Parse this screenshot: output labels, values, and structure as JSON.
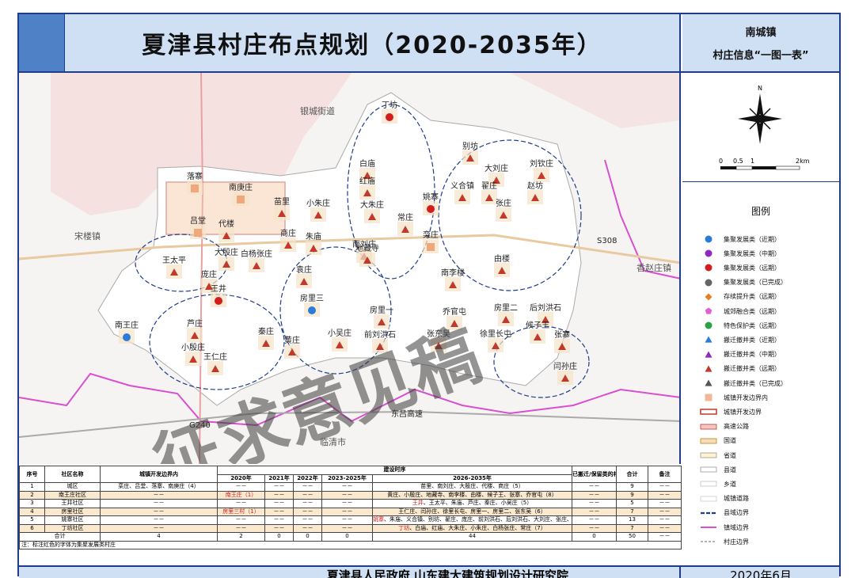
{
  "header": {
    "title": "夏津县村庄布点规划（2020-2035年）",
    "town": "南城镇",
    "subtitle": "村庄信息“一图一表”"
  },
  "map": {
    "places": [
      {
        "name": "丁坊",
        "sym": "red-circle"
      },
      {
        "name": "别坊",
        "sym": "red-triangle"
      },
      {
        "name": "大刘庄",
        "sym": "red-triangle"
      },
      {
        "name": "刘钦庄",
        "sym": "red-triangle"
      },
      {
        "name": "白庙",
        "sym": "red-triangle"
      },
      {
        "name": "红庙",
        "sym": "red-triangle"
      },
      {
        "name": "义合镇",
        "sym": "red-triangle"
      },
      {
        "name": "翟庄",
        "sym": "red-triangle"
      },
      {
        "name": "赵坊",
        "sym": "red-triangle"
      },
      {
        "name": "落寨",
        "sym": "orange-square"
      },
      {
        "name": "南庚庄",
        "sym": "orange-square"
      },
      {
        "name": "苗里",
        "sym": "red-triangle"
      },
      {
        "name": "小朱庄",
        "sym": "red-triangle"
      },
      {
        "name": "大朱庄",
        "sym": "red-triangle"
      },
      {
        "name": "姚寨",
        "sym": "red-circle"
      },
      {
        "name": "张庄",
        "sym": "red-triangle"
      },
      {
        "name": "常庄",
        "sym": "red-triangle"
      },
      {
        "name": "栾庄",
        "sym": "orange-square"
      },
      {
        "name": "吕堂",
        "sym": "orange-square"
      },
      {
        "name": "代楼",
        "sym": "red-triangle"
      },
      {
        "name": "商庄",
        "sym": "red-triangle"
      },
      {
        "name": "朱庙",
        "sym": "red-triangle"
      },
      {
        "name": "南刘庄",
        "sym": "red-triangle"
      },
      {
        "name": "大殷庄",
        "sym": "red-triangle"
      },
      {
        "name": "白杨张庄",
        "sym": "red-triangle"
      },
      {
        "name": "地藏寺",
        "sym": "red-triangle"
      },
      {
        "name": "王太平",
        "sym": "red-triangle"
      },
      {
        "name": "袁庄",
        "sym": "red-triangle"
      },
      {
        "name": "由楼",
        "sym": "red-triangle"
      },
      {
        "name": "庞庄",
        "sym": "red-triangle"
      },
      {
        "name": "南李楼",
        "sym": "red-triangle"
      },
      {
        "name": "王井",
        "sym": "red-circle"
      },
      {
        "name": "房里三",
        "sym": "blue-circle"
      },
      {
        "name": "房里二",
        "sym": "red-triangle"
      },
      {
        "name": "后刘洪石",
        "sym": "red-triangle"
      },
      {
        "name": "乔官屯",
        "sym": "red-triangle"
      },
      {
        "name": "南王庄",
        "sym": "blue-circle"
      },
      {
        "name": "芦庄",
        "sym": "red-triangle"
      },
      {
        "name": "房里一",
        "sym": "red-triangle"
      },
      {
        "name": "候子王",
        "sym": "red-triangle"
      },
      {
        "name": "秦庄",
        "sym": "red-triangle"
      },
      {
        "name": "小吴庄",
        "sym": "red-triangle"
      },
      {
        "name": "前刘洪石",
        "sym": "red-triangle"
      },
      {
        "name": "张东吴",
        "sym": "red-triangle"
      },
      {
        "name": "徐里长屯",
        "sym": "red-triangle"
      },
      {
        "name": "张寨",
        "sym": "red-triangle"
      },
      {
        "name": "黄庄",
        "sym": "red-triangle"
      },
      {
        "name": "小殷庄",
        "sym": "red-triangle"
      },
      {
        "name": "王仁庄",
        "sym": "red-triangle"
      },
      {
        "name": "闫孙庄",
        "sym": "red-triangle"
      }
    ],
    "labels": {
      "nw": "银城街道",
      "west": "宋楼镇",
      "east": "香赵庄镇",
      "south": "临清市",
      "expressway": "东吕高速",
      "road1": "G240",
      "road2": "S308"
    },
    "watermark": "征求意见稿"
  },
  "scale": {
    "ticks": [
      "0",
      "0.5",
      "1",
      "2km"
    ],
    "north": "N"
  },
  "legend": {
    "title": "图例",
    "items": [
      {
        "sym": "blue-circle",
        "label": "集聚发展类（近期）"
      },
      {
        "sym": "purple-circle",
        "label": "集聚发展类（中期）"
      },
      {
        "sym": "red-circle",
        "label": "集聚发展类（远期）"
      },
      {
        "sym": "gray-circle",
        "label": "集聚发展类（已完成）"
      },
      {
        "sym": "orange-diamond",
        "label": "存续提升类（远期）"
      },
      {
        "sym": "pink-pentagon",
        "label": "城郊融合类（远期）"
      },
      {
        "sym": "green-circle",
        "label": "特色保护类（远期）"
      },
      {
        "sym": "blue-triangle",
        "label": "搬迁撤并类（近期）"
      },
      {
        "sym": "purple-triangle",
        "label": "搬迁撤并类（中期）"
      },
      {
        "sym": "red-triangle",
        "label": "搬迁撤并类（远期）"
      },
      {
        "sym": "gray-triangle",
        "label": "搬迁撤并类（已完成）"
      },
      {
        "sym": "salmon-square",
        "label": "城镇开发边界内"
      },
      {
        "sym": "red-box",
        "label": "城镇开发边界"
      },
      {
        "sym": "highway-line",
        "label": "高速公路"
      },
      {
        "sym": "national-line",
        "label": "国道"
      },
      {
        "sym": "provincial-line",
        "label": "省道"
      },
      {
        "sym": "county-line",
        "label": "县道"
      },
      {
        "sym": "village-line",
        "label": "乡道"
      },
      {
        "sym": "town-road-line",
        "label": "城镇道路"
      },
      {
        "sym": "county-border",
        "label": "县域边界"
      },
      {
        "sym": "town-border",
        "label": "镇域边界"
      },
      {
        "sym": "village-border",
        "label": "村庄边界"
      }
    ]
  },
  "table": {
    "headers": {
      "no": "序号",
      "community": "社区名称",
      "inside": "城镇开发边界内",
      "plan": "建设时序",
      "y2020": "2020年",
      "y2021": "2021年",
      "y2022": "2022年",
      "y2023": "2023-2025年",
      "y2026": "2026-2035年",
      "moved": "已搬迁/保留类的村庄",
      "total": "合计",
      "remark": "备注"
    },
    "rows": [
      {
        "no": "1",
        "name": "城区",
        "inside": "栾庄、吕堂、落寨、南庚庄（4）",
        "y2020": "－－",
        "y2020_red": "",
        "y2021": "－－",
        "y2022": "－－",
        "y2023": "－－",
        "y2026": "苗里、南刘庄、大殷庄、代楼、商庄（5）",
        "y2026_red": "",
        "moved": "－－",
        "total": "9",
        "remark": "－－"
      },
      {
        "no": "2",
        "name": "南王庄社区",
        "inside": "－－",
        "y2020": "",
        "y2020_red": "南王庄（1）",
        "y2021": "－－",
        "y2022": "－－",
        "y2023": "－－",
        "y2026": "黄庄、小殷庄、地藏寺、南李楼、由楼、候子王、张寨、乔官屯（8）",
        "y2026_red": "",
        "moved": "－－",
        "total": "9",
        "remark": "－－"
      },
      {
        "no": "3",
        "name": "王井社区",
        "inside": "－－",
        "y2020": "－－",
        "y2020_red": "",
        "y2021": "－－",
        "y2022": "－－",
        "y2023": "－－",
        "y2026": "、王太平、朱庙、芦庄、秦庄、小吴庄（5）",
        "y2026_red": "王井",
        "moved": "－－",
        "total": "5",
        "remark": "－－"
      },
      {
        "no": "4",
        "name": "房里社区",
        "inside": "－－",
        "y2020": "",
        "y2020_red": "房里三村（1）",
        "y2021": "－－",
        "y2022": "－－",
        "y2023": "－－",
        "y2026": "王仁庄、闫孙庄、徐里长屯、房里一、房里二、张东吴（6）",
        "y2026_red": "",
        "moved": "－－",
        "total": "7",
        "remark": "－－"
      },
      {
        "no": "5",
        "name": "姚寨社区",
        "inside": "－－",
        "y2020": "－－",
        "y2020_red": "",
        "y2021": "－－",
        "y2022": "－－",
        "y2023": "－－",
        "y2026": "、朱庙、义合镇、别坊、翟庄、庞庄、前刘洪石、后刘洪石、大刘庄、张庄、袁庄、赵坊、刘钦庄（13）",
        "y2026_red": "姚寨",
        "moved": "－－",
        "total": "13",
        "remark": "－－"
      },
      {
        "no": "6",
        "name": "丁坊社区",
        "inside": "－－",
        "y2020": "－－",
        "y2020_red": "",
        "y2021": "－－",
        "y2022": "－－",
        "y2023": "－－",
        "y2026": "、白庙、红庙、大朱庄、小朱庄、白杨张庄、常庄（7）",
        "y2026_red": "丁坊",
        "moved": "－－",
        "total": "7",
        "remark": "－－"
      }
    ],
    "total_row": {
      "label": "合计",
      "inside": "4",
      "y2020": "2",
      "y2021": "0",
      "y2022": "0",
      "y2023": "0",
      "y2026": "44",
      "moved": "0",
      "total": "50",
      "remark": "－－"
    },
    "note": "注：标注红色的字体为集聚发展类村庄"
  },
  "footer": {
    "left": "夏津县人民政府  山东建大建筑规划设计研究院",
    "right": "2020年6月"
  },
  "colors": {
    "frame": "#1f3d8c",
    "header_bg": "#cfe0f5",
    "accent_blue": "#4f81c7",
    "alt_row": "#fbe9cf"
  }
}
